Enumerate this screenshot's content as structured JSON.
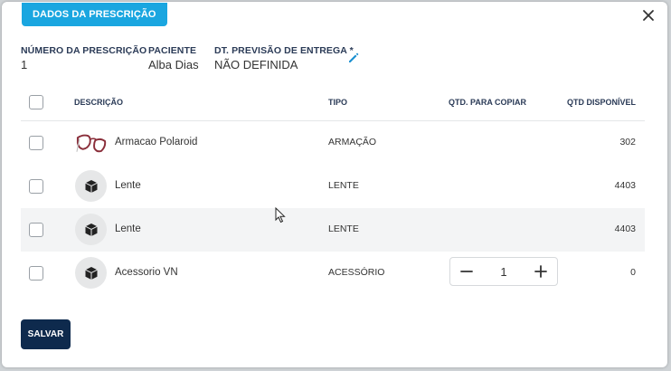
{
  "dialog": {
    "tab_label": "DADOS DA PRESCRIÇÃO",
    "close_icon": "close-icon"
  },
  "fields": {
    "prescription_number_label": "NÚMERO DA PRESCRIÇÃO",
    "prescription_number_value": "1",
    "patient_label": "PACIENTE",
    "patient_value": "Alba Dias",
    "delivery_date_label": "DT. PREVISÃO DE ENTREGA *",
    "delivery_date_value": "NÃO DEFINIDA"
  },
  "table": {
    "headers": {
      "description": "DESCRIÇÃO",
      "type": "TIPO",
      "copy_qty": "QTD. PARA COPIAR",
      "available_qty": "QTD DISPONÍVEL"
    },
    "rows": [
      {
        "name": "Armacao Polaroid",
        "type": "ARMAÇÃO",
        "available": "302",
        "icon": "glasses-frame-image"
      },
      {
        "name": "Lente",
        "type": "LENTE",
        "available": "4403",
        "icon": "box-icon"
      },
      {
        "name": "Lente",
        "type": "LENTE",
        "available": "4403",
        "icon": "box-icon"
      },
      {
        "name": "Acessorio VN",
        "type": "ACESSÓRIO",
        "available": "0",
        "icon": "box-icon",
        "copy_qty": "1"
      }
    ]
  },
  "actions": {
    "save_label": "SALVAR"
  },
  "colors": {
    "tab_chip": "#1aa6e0",
    "save_button": "#0e2a4d",
    "edit_icon": "#1a8fd0",
    "header_text": "#2b3b57"
  }
}
